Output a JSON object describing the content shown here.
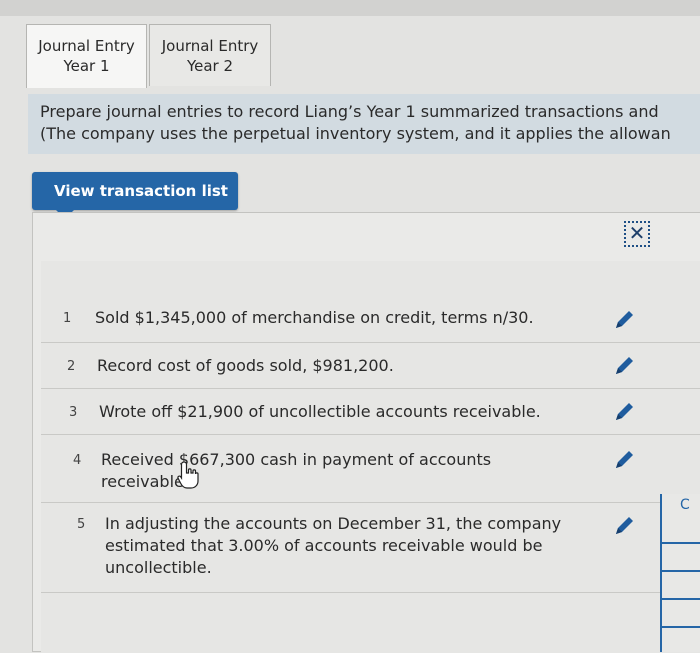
{
  "tabs": [
    {
      "line1": "Journal Entry",
      "line2": "Year 1"
    },
    {
      "line1": "Journal Entry",
      "line2": "Year 2"
    }
  ],
  "prompt": {
    "line1": "Prepare journal entries to record Liang’s Year 1 summarized transactions and",
    "line2": "(The company uses the perpetual inventory system, and it applies the allowan"
  },
  "view_button_label": "View transaction list",
  "close_icon_glyph": "✕",
  "transactions": [
    {
      "num": "1",
      "line1": "Sold $1,345,000 of merchandise on credit, terms n/30.",
      "line2": "",
      "line3": ""
    },
    {
      "num": "2",
      "line1": "Record cost of goods sold, $981,200.",
      "line2": "",
      "line3": ""
    },
    {
      "num": "3",
      "line1": "Wrote off $21,900 of uncollectible accounts receivable.",
      "line2": "",
      "line3": ""
    },
    {
      "num": "4",
      "line1": "Received $667,300 cash in payment of accounts",
      "line2": "receivable.",
      "line3": ""
    },
    {
      "num": "5",
      "line1": "In adjusting the accounts on December 31, the company",
      "line2": "estimated that 3.00% of accounts receivable would be",
      "line3": "uncollectible."
    }
  ],
  "edge_label": "C",
  "icons": [
    "close-icon",
    "edit-pencil-icon",
    "hand-cursor-icon"
  ],
  "colors": {
    "accent": "#2566a7",
    "prompt_bg": "#d2dbe1",
    "panel_bg": "#eaeae8"
  }
}
